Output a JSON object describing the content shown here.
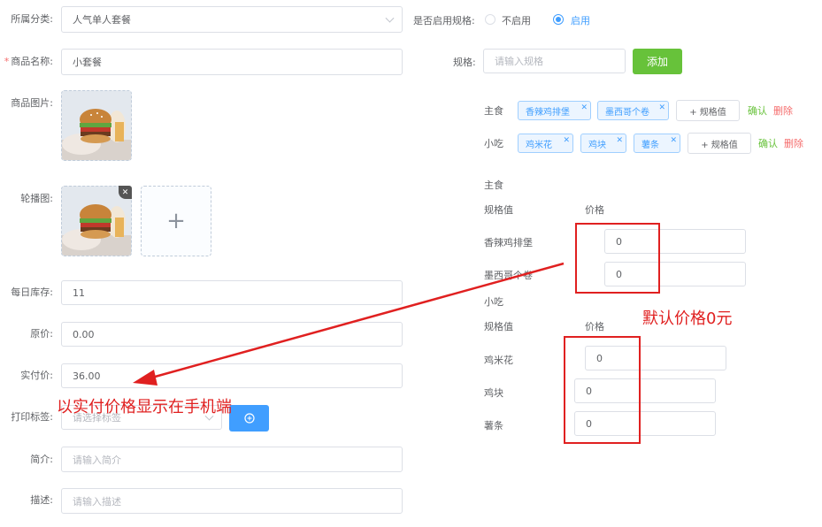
{
  "left": {
    "category": {
      "label": "所属分类:",
      "value": "人气单人套餐"
    },
    "name": {
      "required": "*",
      "label": "商品名称:",
      "value": "小套餐"
    },
    "image": {
      "label": "商品图片:"
    },
    "carousel": {
      "label": "轮播图:",
      "remove": "✕",
      "add": "+"
    },
    "stock": {
      "label": "每日库存:",
      "value": "11"
    },
    "original_price": {
      "label": "原价:",
      "value": "0.00"
    },
    "actual_price": {
      "label": "实付价:",
      "value": "36.00"
    },
    "print_tag": {
      "label": "打印标签:",
      "placeholder": "请选择标签"
    },
    "brief": {
      "label": "简介:",
      "placeholder": "请输入简介"
    },
    "desc": {
      "label": "描述:",
      "placeholder": "请输入描述"
    }
  },
  "right": {
    "spec_enable": {
      "label": "是否启用规格:",
      "option_off": "不启用",
      "option_on": "启用",
      "selected": "启用"
    },
    "spec": {
      "label": "规格:",
      "placeholder": "请输入规格",
      "add_button": "添加"
    },
    "groups": [
      {
        "name": "主食",
        "tags": [
          "香辣鸡排堡",
          "墨西哥个卷"
        ],
        "add_value": "+ 规格值",
        "confirm": "确认",
        "delete": "删除"
      },
      {
        "name": "小吃",
        "tags": [
          "鸡米花",
          "鸡块",
          "薯条"
        ],
        "add_value": "+ 规格值",
        "confirm": "确认",
        "delete": "删除"
      }
    ],
    "price_tables": [
      {
        "title": "主食",
        "col_value": "规格值",
        "col_price": "价格",
        "rows": [
          {
            "name": "香辣鸡排堡",
            "price": "0"
          },
          {
            "name": "墨西哥个卷",
            "price": "0"
          }
        ]
      },
      {
        "title": "小吃",
        "col_value": "规格值",
        "col_price": "价格",
        "rows": [
          {
            "name": "鸡米花",
            "price": "0"
          },
          {
            "name": "鸡块",
            "price": "0"
          },
          {
            "name": "薯条",
            "price": "0"
          }
        ]
      }
    ]
  },
  "annotations": {
    "default_price": "默认价格0元",
    "actual_price_note": "以实付价格显示在手机端"
  },
  "colors": {
    "accent": "#409eff",
    "success": "#67c23a",
    "danger": "#f56c6c",
    "annotation": "#e02020"
  }
}
